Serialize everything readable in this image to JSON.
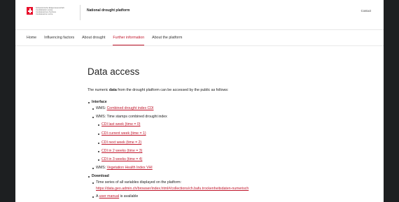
{
  "header": {
    "confederation_lines": [
      "Schweizerische Eidgenossenschaft",
      "Confédération suisse",
      "Confederazione Svizzera",
      "Confederaziun svizra"
    ],
    "app_title": "National drought platform",
    "contact": "Contact"
  },
  "nav": {
    "items": [
      {
        "label": "Home"
      },
      {
        "label": "Influencing factors"
      },
      {
        "label": "About drought"
      },
      {
        "label": "Further information",
        "active": true
      },
      {
        "label": "About the platform"
      }
    ]
  },
  "main": {
    "title": "Data access",
    "intro_before": "The numeric ",
    "intro_bold": "data",
    "intro_after": " from the drought platform can be accessed by the public as follows:",
    "interface": {
      "heading": "Interface",
      "wms1_prefix": "WMS: ",
      "wms1_link": "Combined drought index CDI",
      "wms2_text": "WMS: Time stamps combined drought index",
      "timestamps": [
        "CDI last week (time = 0)",
        "CDI current week (time = 1)",
        "CDI next week (time = 2)",
        "CDI in 2 weeks (time = 3)",
        "CDI in 3 weeks (time = 4)"
      ],
      "wms3_prefix": "WMS: ",
      "wms3_link": "Vegetation Health Index VHI"
    },
    "download": {
      "heading": "Download",
      "item1_text": "Time series of all variables displayed on the platform:",
      "item1_link": "https://data.geo.admin.ch/browser/index.html#/collections/ch.bafu.trockenheitsdaten-numerisch",
      "item2_prefix": "A ",
      "item2_link": "user manual",
      "item2_suffix": " is available"
    }
  },
  "colors": {
    "accent": "#c0162b",
    "swiss_red": "#e8112d",
    "backdrop": "#1d1f21"
  }
}
